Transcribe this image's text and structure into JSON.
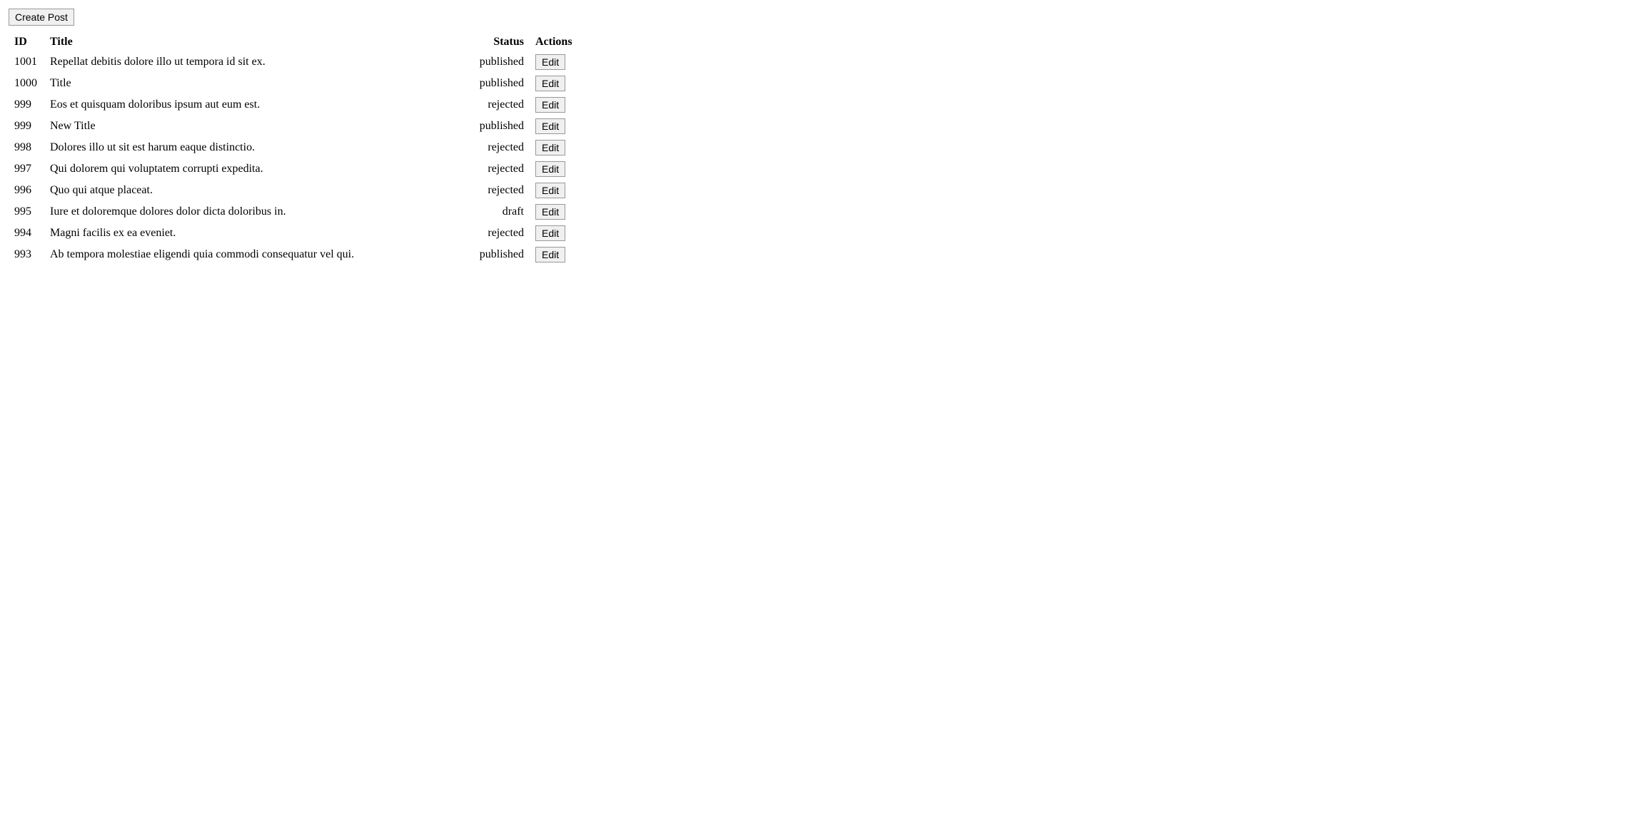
{
  "toolbar": {
    "create_post_label": "Create Post"
  },
  "table": {
    "headers": {
      "id": "ID",
      "title": "Title",
      "status": "Status",
      "actions": "Actions"
    },
    "rows": [
      {
        "id": "1001",
        "title": "Repellat debitis dolore illo ut tempora id sit ex.",
        "status": "published",
        "edit_label": "Edit"
      },
      {
        "id": "1000",
        "title": "Title",
        "status": "published",
        "edit_label": "Edit"
      },
      {
        "id": "999",
        "title": "Eos et quisquam doloribus ipsum aut eum est.",
        "status": "rejected",
        "edit_label": "Edit"
      },
      {
        "id": "999",
        "title": "New Title",
        "status": "published",
        "edit_label": "Edit"
      },
      {
        "id": "998",
        "title": "Dolores illo ut sit est harum eaque distinctio.",
        "status": "rejected",
        "edit_label": "Edit"
      },
      {
        "id": "997",
        "title": "Qui dolorem qui voluptatem corrupti expedita.",
        "status": "rejected",
        "edit_label": "Edit"
      },
      {
        "id": "996",
        "title": "Quo qui atque placeat.",
        "status": "rejected",
        "edit_label": "Edit"
      },
      {
        "id": "995",
        "title": "Iure et doloremque dolores dolor dicta doloribus in.",
        "status": "draft",
        "edit_label": "Edit"
      },
      {
        "id": "994",
        "title": "Magni facilis ex ea eveniet.",
        "status": "rejected",
        "edit_label": "Edit"
      },
      {
        "id": "993",
        "title": "Ab tempora molestiae eligendi quia commodi consequatur vel qui.",
        "status": "published",
        "edit_label": "Edit"
      }
    ]
  }
}
